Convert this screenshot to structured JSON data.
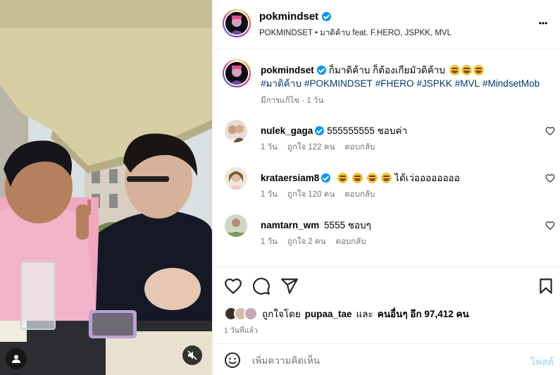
{
  "header": {
    "username": "pokmindset",
    "subtitle": "POKMINDSET • มาดิค้าบ feat. F.HERO, JSPKK, MVL",
    "more_label": "•••"
  },
  "caption": {
    "username": "pokmindset",
    "text": "ก็มาดิค้าบ ก็ต้องเกียมัวดิค้าบ",
    "emojis": [
      "rolling-on-floor-laughing",
      "rolling-on-floor-laughing",
      "rolling-on-floor-laughing"
    ],
    "hashtags": [
      "#มาดิค้าบ",
      "#POKMINDSET",
      "#FHERO",
      "#JSPKK",
      "#MVL",
      "#MindsetMob"
    ],
    "meta": "มีการแก้ไข · 1 วัน"
  },
  "comments": [
    {
      "username": "nulek_gaga",
      "verified": true,
      "text": "555555555 ชอบค่า",
      "emojis": [],
      "time": "1 วัน",
      "likes": "ถูกใจ 122 คน",
      "reply": "ตอบกลับ"
    },
    {
      "username": "krataersiam8",
      "verified": true,
      "text": "ได้เว่ออออออออ",
      "emojis": [
        "grinning-squinting-face",
        "grinning-squinting-face",
        "grinning-squinting-face",
        "grinning-squinting-face"
      ],
      "time": "1 วัน",
      "likes": "ถูกใจ 120 คน",
      "reply": "ตอบกลับ"
    },
    {
      "username": "namtarn_wm",
      "verified": false,
      "text": "5555 ชอบๆ",
      "emojis": [],
      "time": "1 วัน",
      "likes": "ถูกใจ 2 คน",
      "reply": "ตอบกลับ"
    }
  ],
  "likes": {
    "prefix": "ถูกใจโดย",
    "first_user": "pupaa_tae",
    "middle": "และ",
    "others": "คนอื่นๆ อีก 97,412 คน"
  },
  "time_ago": "1 วันที่แล้ว",
  "add_comment": {
    "placeholder": "เพิ่มความคิดเห็น",
    "post_label": "โพสต์"
  },
  "colors": {
    "link": "#00376b",
    "verified": "#0095f6",
    "muted": "#737373",
    "post_disabled": "#b2dffc"
  },
  "icons": {
    "header_verified": "verified-badge-icon",
    "more": "more-options-icon",
    "like": "heart-icon",
    "comment": "comment-icon",
    "share": "share-icon",
    "save": "bookmark-icon",
    "emoji": "smiley-icon",
    "user_tag": "user-tag-icon",
    "mute": "muted-speaker-icon"
  }
}
